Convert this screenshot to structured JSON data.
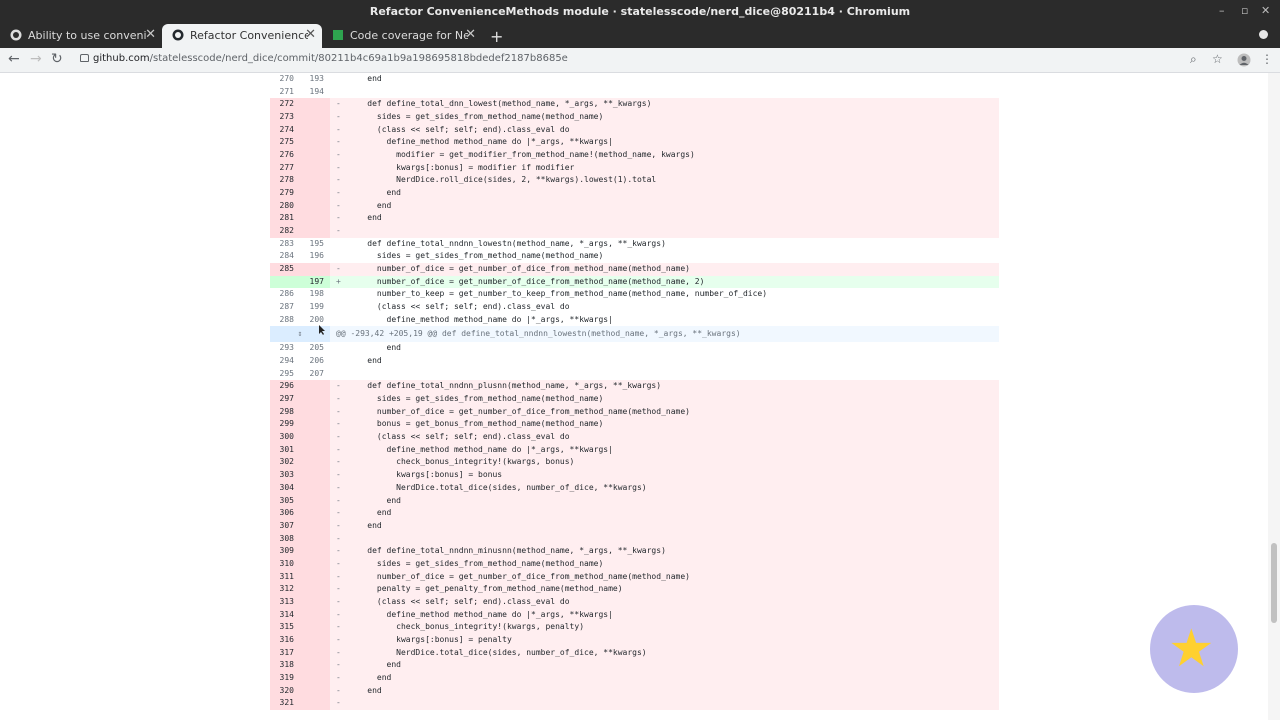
{
  "window": {
    "title": "Refactor ConvenienceMethods module · statelesscode/nerd_dice@80211b4 · Chromium"
  },
  "tabs": [
    {
      "label": "Ability to use convenience",
      "icon": "github-icon",
      "active": false
    },
    {
      "label": "Refactor ConvenienceMe",
      "icon": "github-icon",
      "active": true
    },
    {
      "label": "Code coverage for Nerd d",
      "icon": "coverage-icon",
      "active": false
    }
  ],
  "toolbar": {
    "url_host": "github.com",
    "url_path": "/statelesscode/nerd_dice/commit/80211b4c69a1b9a198695818bdedef2187b8685e"
  },
  "diff_rows": [
    {
      "type": "ctx",
      "old": "270",
      "new": "193",
      "mk": " ",
      "code": "    end"
    },
    {
      "type": "ctx",
      "old": "271",
      "new": "194",
      "mk": " ",
      "code": ""
    },
    {
      "type": "del",
      "old": "272",
      "new": "",
      "mk": "-",
      "code": "    def define_total_dnn_lowest(method_name, *_args, **_kwargs)"
    },
    {
      "type": "del",
      "old": "273",
      "new": "",
      "mk": "-",
      "code": "      sides = get_sides_from_method_name(method_name)"
    },
    {
      "type": "del",
      "old": "274",
      "new": "",
      "mk": "-",
      "code": "      (class << self; self; end).class_eval do"
    },
    {
      "type": "del",
      "old": "275",
      "new": "",
      "mk": "-",
      "code": "        define_method method_name do |*_args, **kwargs|"
    },
    {
      "type": "del",
      "old": "276",
      "new": "",
      "mk": "-",
      "code": "          modifier = get_modifier_from_method_name!(method_name, kwargs)"
    },
    {
      "type": "del",
      "old": "277",
      "new": "",
      "mk": "-",
      "code": "          kwargs[:bonus] = modifier if modifier"
    },
    {
      "type": "del",
      "old": "278",
      "new": "",
      "mk": "-",
      "code": "          NerdDice.roll_dice(sides, 2, **kwargs).lowest(1).total"
    },
    {
      "type": "del",
      "old": "279",
      "new": "",
      "mk": "-",
      "code": "        end"
    },
    {
      "type": "del",
      "old": "280",
      "new": "",
      "mk": "-",
      "code": "      end"
    },
    {
      "type": "del",
      "old": "281",
      "new": "",
      "mk": "-",
      "code": "    end"
    },
    {
      "type": "del",
      "old": "282",
      "new": "",
      "mk": "-",
      "code": ""
    },
    {
      "type": "ctx",
      "old": "283",
      "new": "195",
      "mk": " ",
      "code": "    def define_total_nndnn_lowestn(method_name, *_args, **_kwargs)"
    },
    {
      "type": "ctx",
      "old": "284",
      "new": "196",
      "mk": " ",
      "code": "      sides = get_sides_from_method_name(method_name)"
    },
    {
      "type": "del",
      "old": "285",
      "new": "",
      "mk": "-",
      "code": "      number_of_dice = get_number_of_dice_from_method_name(method_name)"
    },
    {
      "type": "add",
      "old": "",
      "new": "197",
      "mk": "+",
      "code": "      number_of_dice = get_number_of_dice_from_method_name(method_name, 2)"
    },
    {
      "type": "ctx",
      "old": "286",
      "new": "198",
      "mk": " ",
      "code": "      number_to_keep = get_number_to_keep_from_method_name(method_name, number_of_dice)"
    },
    {
      "type": "ctx",
      "old": "287",
      "new": "199",
      "mk": " ",
      "code": "      (class << self; self; end).class_eval do"
    },
    {
      "type": "ctx",
      "old": "288",
      "new": "200",
      "mk": " ",
      "code": "        define_method method_name do |*_args, **kwargs|"
    },
    {
      "type": "hunk",
      "old": "",
      "new": "",
      "mk": "",
      "code": "@@ -293,42 +205,19 @@ def define_total_nndnn_lowestn(method_name, *_args, **_kwargs)"
    },
    {
      "type": "ctx",
      "old": "293",
      "new": "205",
      "mk": " ",
      "code": "        end"
    },
    {
      "type": "ctx",
      "old": "294",
      "new": "206",
      "mk": " ",
      "code": "    end"
    },
    {
      "type": "ctx",
      "old": "295",
      "new": "207",
      "mk": " ",
      "code": ""
    },
    {
      "type": "del",
      "old": "296",
      "new": "",
      "mk": "-",
      "code": "    def define_total_nndnn_plusnn(method_name, *_args, **_kwargs)"
    },
    {
      "type": "del",
      "old": "297",
      "new": "",
      "mk": "-",
      "code": "      sides = get_sides_from_method_name(method_name)"
    },
    {
      "type": "del",
      "old": "298",
      "new": "",
      "mk": "-",
      "code": "      number_of_dice = get_number_of_dice_from_method_name(method_name)"
    },
    {
      "type": "del",
      "old": "299",
      "new": "",
      "mk": "-",
      "code": "      bonus = get_bonus_from_method_name(method_name)"
    },
    {
      "type": "del",
      "old": "300",
      "new": "",
      "mk": "-",
      "code": "      (class << self; self; end).class_eval do"
    },
    {
      "type": "del",
      "old": "301",
      "new": "",
      "mk": "-",
      "code": "        define_method method_name do |*_args, **kwargs|"
    },
    {
      "type": "del",
      "old": "302",
      "new": "",
      "mk": "-",
      "code": "          check_bonus_integrity!(kwargs, bonus)"
    },
    {
      "type": "del",
      "old": "303",
      "new": "",
      "mk": "-",
      "code": "          kwargs[:bonus] = bonus"
    },
    {
      "type": "del",
      "old": "304",
      "new": "",
      "mk": "-",
      "code": "          NerdDice.total_dice(sides, number_of_dice, **kwargs)"
    },
    {
      "type": "del",
      "old": "305",
      "new": "",
      "mk": "-",
      "code": "        end"
    },
    {
      "type": "del",
      "old": "306",
      "new": "",
      "mk": "-",
      "code": "      end"
    },
    {
      "type": "del",
      "old": "307",
      "new": "",
      "mk": "-",
      "code": "    end"
    },
    {
      "type": "del",
      "old": "308",
      "new": "",
      "mk": "-",
      "code": ""
    },
    {
      "type": "del",
      "old": "309",
      "new": "",
      "mk": "-",
      "code": "    def define_total_nndnn_minusnn(method_name, *_args, **_kwargs)"
    },
    {
      "type": "del",
      "old": "310",
      "new": "",
      "mk": "-",
      "code": "      sides = get_sides_from_method_name(method_name)"
    },
    {
      "type": "del",
      "old": "311",
      "new": "",
      "mk": "-",
      "code": "      number_of_dice = get_number_of_dice_from_method_name(method_name)"
    },
    {
      "type": "del",
      "old": "312",
      "new": "",
      "mk": "-",
      "code": "      penalty = get_penalty_from_method_name(method_name)"
    },
    {
      "type": "del",
      "old": "313",
      "new": "",
      "mk": "-",
      "code": "      (class << self; self; end).class_eval do"
    },
    {
      "type": "del",
      "old": "314",
      "new": "",
      "mk": "-",
      "code": "        define_method method_name do |*_args, **kwargs|"
    },
    {
      "type": "del",
      "old": "315",
      "new": "",
      "mk": "-",
      "code": "          check_bonus_integrity!(kwargs, penalty)"
    },
    {
      "type": "del",
      "old": "316",
      "new": "",
      "mk": "-",
      "code": "          kwargs[:bonus] = penalty"
    },
    {
      "type": "del",
      "old": "317",
      "new": "",
      "mk": "-",
      "code": "          NerdDice.total_dice(sides, number_of_dice, **kwargs)"
    },
    {
      "type": "del",
      "old": "318",
      "new": "",
      "mk": "-",
      "code": "        end"
    },
    {
      "type": "del",
      "old": "319",
      "new": "",
      "mk": "-",
      "code": "      end"
    },
    {
      "type": "del",
      "old": "320",
      "new": "",
      "mk": "-",
      "code": "    end"
    },
    {
      "type": "del",
      "old": "321",
      "new": "",
      "mk": "-",
      "code": ""
    }
  ]
}
